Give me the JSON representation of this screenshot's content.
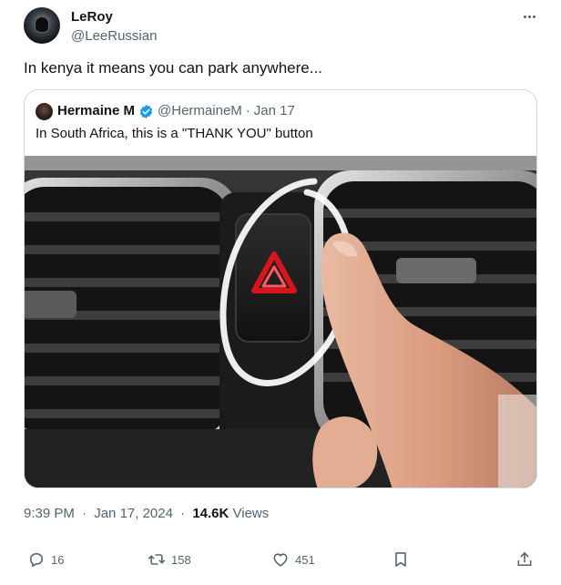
{
  "author": {
    "name": "LeRoy",
    "handle": "@LeeRussian"
  },
  "tweet": {
    "text": "In kenya it means you can park anywhere..."
  },
  "quoted": {
    "name": "Hermaine M",
    "handle": "@HermaineM",
    "separator": "·",
    "date": "Jan 17",
    "text": "In South Africa, this is a \"THANK YOU\" button",
    "verified": true
  },
  "meta": {
    "time": "9:39 PM",
    "separator": "·",
    "date": "Jan 17, 2024",
    "views_count": "14.6K",
    "views_label": "Views"
  },
  "actions": {
    "reply_count": "16",
    "retweet_count": "158",
    "like_count": "451"
  },
  "icons": {
    "more": "more-dots-icon",
    "verified": "verified-badge-icon",
    "reply": "reply-icon",
    "retweet": "retweet-icon",
    "like": "heart-icon",
    "bookmark": "bookmark-icon",
    "share": "share-icon"
  },
  "colors": {
    "text_primary": "#0f1419",
    "text_secondary": "#536471",
    "border": "#cfd9de",
    "verified_blue": "#1d9bf0",
    "hazard_red": "#d8141c"
  }
}
